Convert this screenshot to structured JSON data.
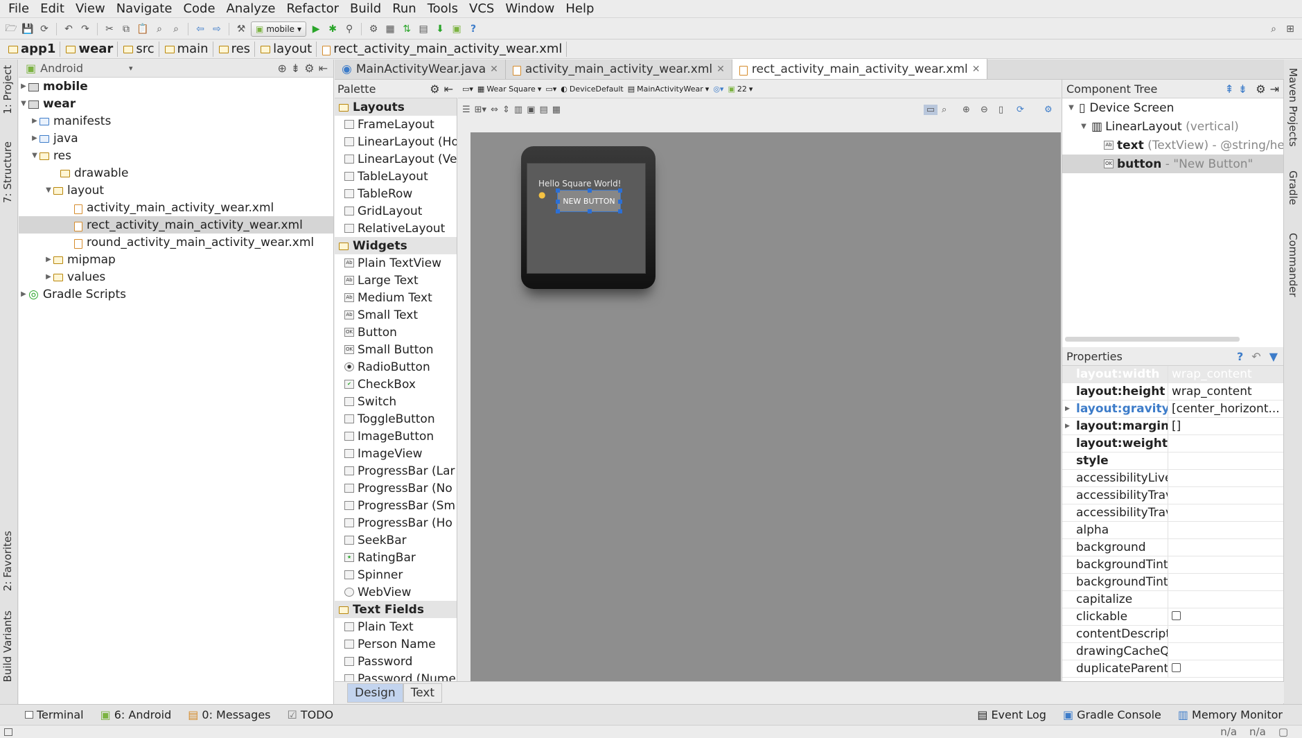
{
  "menu": [
    "File",
    "Edit",
    "View",
    "Navigate",
    "Code",
    "Analyze",
    "Refactor",
    "Build",
    "Run",
    "Tools",
    "VCS",
    "Window",
    "Help"
  ],
  "toolbar": {
    "run_config": "mobile",
    "help": "?"
  },
  "breadcrumb": [
    "app1",
    "wear",
    "src",
    "main",
    "res",
    "layout",
    "rect_activity_main_activity_wear.xml"
  ],
  "left_strip": {
    "project": "1: Project",
    "structure": "7: Structure",
    "favorites": "2: Favorites",
    "build_variants": "Build Variants"
  },
  "right_strip": {
    "maven": "Maven Projects",
    "gradle": "Gradle",
    "commander": "Commander"
  },
  "project_panel": {
    "view_mode": "Android",
    "tree": [
      {
        "label": "mobile",
        "bold": true
      },
      {
        "label": "wear",
        "bold": true
      },
      {
        "label": "manifests"
      },
      {
        "label": "java"
      },
      {
        "label": "res"
      },
      {
        "label": "drawable"
      },
      {
        "label": "layout"
      },
      {
        "label": "activity_main_activity_wear.xml"
      },
      {
        "label": "rect_activity_main_activity_wear.xml"
      },
      {
        "label": "round_activity_main_activity_wear.xml"
      },
      {
        "label": "mipmap"
      },
      {
        "label": "values"
      },
      {
        "label": "Gradle Scripts"
      }
    ]
  },
  "editor_tabs": [
    {
      "label": "MainActivityWear.java"
    },
    {
      "label": "activity_main_activity_wear.xml"
    },
    {
      "label": "rect_activity_main_activity_wear.xml"
    }
  ],
  "palette": {
    "title": "Palette",
    "groups": [
      {
        "label": "Layouts",
        "items": [
          "FrameLayout",
          "LinearLayout (Ho",
          "LinearLayout (Ve",
          "TableLayout",
          "TableRow",
          "GridLayout",
          "RelativeLayout"
        ]
      },
      {
        "label": "Widgets",
        "items": [
          "Plain TextView",
          "Large Text",
          "Medium Text",
          "Small Text",
          "Button",
          "Small Button",
          "RadioButton",
          "CheckBox",
          "Switch",
          "ToggleButton",
          "ImageButton",
          "ImageView",
          "ProgressBar (Lar",
          "ProgressBar (No",
          "ProgressBar (Sm",
          "ProgressBar (Ho",
          "SeekBar",
          "RatingBar",
          "Spinner",
          "WebView"
        ]
      },
      {
        "label": "Text Fields",
        "items": [
          "Plain Text",
          "Person Name",
          "Password",
          "Password (Nume"
        ]
      }
    ]
  },
  "design_toolbar": {
    "device": "Wear Square",
    "theme": "DeviceDefault",
    "activity": "MainActivityWear",
    "api": "22"
  },
  "preview": {
    "text": "Hello Square World!",
    "button": "NEW BUTTON"
  },
  "design_tabs": {
    "design": "Design",
    "text": "Text"
  },
  "component_tree": {
    "title": "Component Tree",
    "rows": [
      {
        "name": "Device Screen",
        "detail": ""
      },
      {
        "name": "LinearLayout",
        "detail": "(vertical)"
      },
      {
        "name": "text",
        "detail": "(TextView) - @string/hell"
      },
      {
        "name": "button",
        "detail": "- \"New Button\""
      }
    ]
  },
  "properties": {
    "title": "Properties",
    "rows": [
      {
        "name": "layout:width",
        "value": "wrap_content"
      },
      {
        "name": "layout:height",
        "value": "wrap_content"
      },
      {
        "name": "layout:gravity",
        "value": "[center_horizont..."
      },
      {
        "name": "layout:margin",
        "value": "[]"
      },
      {
        "name": "layout:weight",
        "value": ""
      },
      {
        "name": "style",
        "value": ""
      },
      {
        "name": "accessibilityLiveR",
        "value": ""
      },
      {
        "name": "accessibilityTrave",
        "value": ""
      },
      {
        "name": "accessibilityTrave",
        "value": ""
      },
      {
        "name": "alpha",
        "value": ""
      },
      {
        "name": "background",
        "value": ""
      },
      {
        "name": "backgroundTint",
        "value": ""
      },
      {
        "name": "backgroundTintM",
        "value": ""
      },
      {
        "name": "capitalize",
        "value": ""
      },
      {
        "name": "clickable",
        "value": ""
      },
      {
        "name": "contentDescript",
        "value": ""
      },
      {
        "name": "drawingCacheQu",
        "value": ""
      },
      {
        "name": "duplicateParentS",
        "value": ""
      }
    ]
  },
  "tool_windows": {
    "terminal": "Terminal",
    "android": "6: Android",
    "messages": "0: Messages",
    "todo": "TODO",
    "event_log": "Event Log",
    "gradle_console": "Gradle Console",
    "memory_monitor": "Memory Monitor"
  },
  "status": {
    "a": "n/a",
    "b": "n/a"
  },
  "colors": {
    "selection": "#d5d5d5",
    "accent_blue": "#3d7cc9",
    "canvas": "#8e8e8e"
  }
}
